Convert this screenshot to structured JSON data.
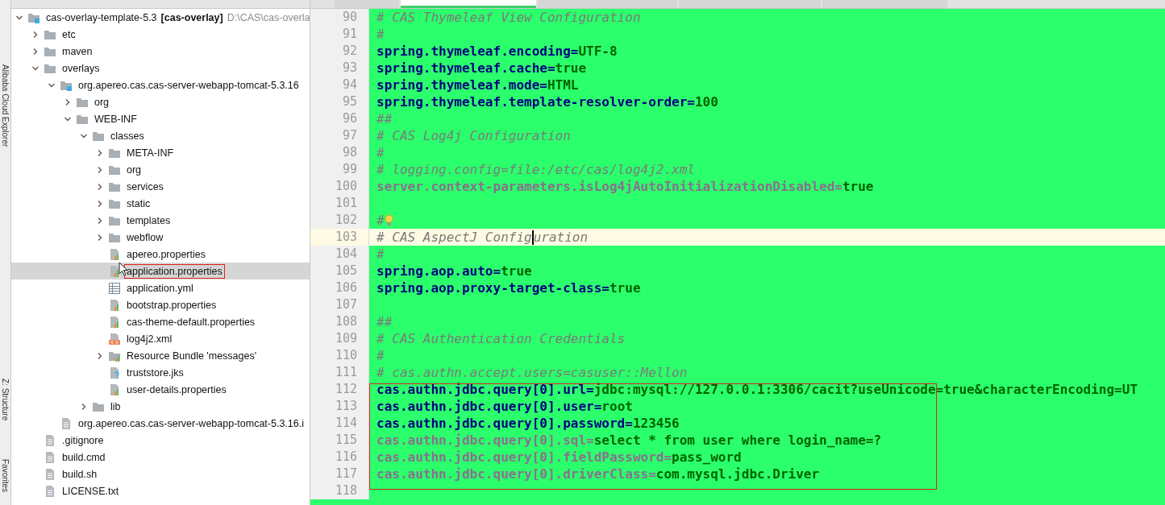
{
  "side_tools": [
    {
      "label": "Alibaba Cloud Explorer"
    },
    {
      "label": "Z: Structure"
    },
    {
      "label": "Favorites"
    }
  ],
  "editor_tabs": [
    {
      "selected": false
    },
    {
      "selected": true
    },
    {
      "selected": false
    },
    {
      "selected": false
    },
    {
      "selected": false
    }
  ],
  "project_tree": [
    {
      "name": "cas-overlay-template-5.3",
      "module": "[cas-overlay]",
      "path": "D:\\CAS\\cas-overla",
      "kind": "module",
      "expanded": true,
      "selected": false,
      "annotated": false,
      "children": [
        {
          "name": "etc",
          "kind": "folder",
          "expanded": false,
          "selected": false,
          "annotated": false
        },
        {
          "name": "maven",
          "kind": "folder",
          "expanded": false,
          "selected": false,
          "annotated": false
        },
        {
          "name": "overlays",
          "kind": "folder",
          "expanded": true,
          "selected": false,
          "annotated": false,
          "children": [
            {
              "name": "org.apereo.cas.cas-server-webapp-tomcat-5.3.16",
              "kind": "module",
              "expanded": true,
              "selected": false,
              "annotated": false,
              "children": [
                {
                  "name": "org",
                  "kind": "folder",
                  "expanded": false,
                  "selected": false,
                  "annotated": false
                },
                {
                  "name": "WEB-INF",
                  "kind": "folder",
                  "expanded": true,
                  "selected": false,
                  "annotated": false,
                  "children": [
                    {
                      "name": "classes",
                      "kind": "folder",
                      "expanded": true,
                      "selected": false,
                      "annotated": false,
                      "children": [
                        {
                          "name": "META-INF",
                          "kind": "folder",
                          "expanded": false,
                          "selected": false,
                          "annotated": false
                        },
                        {
                          "name": "org",
                          "kind": "folder",
                          "expanded": false,
                          "selected": false,
                          "annotated": false
                        },
                        {
                          "name": "services",
                          "kind": "folder",
                          "expanded": false,
                          "selected": false,
                          "annotated": false
                        },
                        {
                          "name": "static",
                          "kind": "folder",
                          "expanded": false,
                          "selected": false,
                          "annotated": false
                        },
                        {
                          "name": "templates",
                          "kind": "folder",
                          "expanded": false,
                          "selected": false,
                          "annotated": false
                        },
                        {
                          "name": "webflow",
                          "kind": "folder",
                          "expanded": false,
                          "selected": false,
                          "annotated": false
                        },
                        {
                          "name": "apereo.properties",
                          "kind": "properties",
                          "selected": false,
                          "annotated": false
                        },
                        {
                          "name": "application.properties",
                          "kind": "properties",
                          "selected": true,
                          "annotated": true
                        },
                        {
                          "name": "application.yml",
                          "kind": "yml",
                          "selected": false,
                          "annotated": false
                        },
                        {
                          "name": "bootstrap.properties",
                          "kind": "properties",
                          "selected": false,
                          "annotated": false
                        },
                        {
                          "name": "cas-theme-default.properties",
                          "kind": "properties",
                          "selected": false,
                          "annotated": false
                        },
                        {
                          "name": "log4j2.xml",
                          "kind": "xml",
                          "selected": false,
                          "annotated": false
                        },
                        {
                          "name": "Resource Bundle 'messages'",
                          "kind": "bundle",
                          "expanded": false,
                          "selected": false,
                          "annotated": false
                        },
                        {
                          "name": "truststore.jks",
                          "kind": "unknown",
                          "selected": false,
                          "annotated": false
                        },
                        {
                          "name": "user-details.properties",
                          "kind": "properties",
                          "selected": false,
                          "annotated": false
                        }
                      ]
                    },
                    {
                      "name": "lib",
                      "kind": "folder",
                      "expanded": false,
                      "selected": false,
                      "annotated": false
                    }
                  ]
                }
              ]
            },
            {
              "name": "org.apereo.cas.cas-server-webapp-tomcat-5.3.16.i",
              "kind": "text",
              "selected": false,
              "annotated": false
            }
          ]
        },
        {
          "name": ".gitignore",
          "kind": "text",
          "selected": false,
          "annotated": false
        },
        {
          "name": "build.cmd",
          "kind": "text",
          "selected": false,
          "annotated": false
        },
        {
          "name": "build.sh",
          "kind": "text",
          "selected": false,
          "annotated": false
        },
        {
          "name": "LICENSE.txt",
          "kind": "text",
          "selected": false,
          "annotated": false
        }
      ]
    }
  ],
  "code_lines": [
    {
      "number": "90",
      "kind": "comment",
      "text": "# CAS Thymeleaf View Configuration",
      "current": false
    },
    {
      "number": "91",
      "kind": "comment",
      "text": "#",
      "current": false
    },
    {
      "number": "92",
      "kind": "property",
      "key": "spring.thymeleaf.encoding=",
      "value": "UTF-8",
      "current": false
    },
    {
      "number": "93",
      "kind": "property",
      "key": "spring.thymeleaf.cache=",
      "value": "true",
      "current": false
    },
    {
      "number": "94",
      "kind": "property",
      "key": "spring.thymeleaf.mode=",
      "value": "HTML",
      "current": false
    },
    {
      "number": "95",
      "kind": "property",
      "key": "spring.thymeleaf.template-resolver-order=",
      "value": "100",
      "current": false
    },
    {
      "number": "96",
      "kind": "comment",
      "text": "##",
      "current": false
    },
    {
      "number": "97",
      "kind": "comment",
      "text": "# CAS Log4j Configuration",
      "current": false
    },
    {
      "number": "98",
      "kind": "comment",
      "text": "#",
      "current": false
    },
    {
      "number": "99",
      "kind": "comment",
      "text": "# logging.config=file:/etc/cas/log4j2.xml",
      "current": false
    },
    {
      "number": "100",
      "kind": "unused_property",
      "key": "server.context-parameters.isLog4jAutoInitializationDisabled=",
      "value": "true",
      "current": false
    },
    {
      "number": "101",
      "kind": "blank",
      "current": false
    },
    {
      "number": "102",
      "kind": "comment",
      "text": "#",
      "current": false,
      "bulb": true
    },
    {
      "number": "103",
      "kind": "comment",
      "text": "# CAS AspectJ Config",
      "after_caret": "uration",
      "current": true
    },
    {
      "number": "104",
      "kind": "comment",
      "text": "#",
      "current": false
    },
    {
      "number": "105",
      "kind": "property",
      "key": "spring.aop.auto=",
      "value": "true",
      "current": false
    },
    {
      "number": "106",
      "kind": "property",
      "key": "spring.aop.proxy-target-class=",
      "value": "true",
      "current": false
    },
    {
      "number": "107",
      "kind": "blank",
      "current": false
    },
    {
      "number": "108",
      "kind": "comment",
      "text": "##",
      "current": false
    },
    {
      "number": "109",
      "kind": "comment",
      "text": "# CAS Authentication Credentials",
      "current": false
    },
    {
      "number": "110",
      "kind": "comment",
      "text": "#",
      "current": false
    },
    {
      "number": "111",
      "kind": "comment",
      "text": "# cas.authn.accept.users=casuser::Mellon",
      "current": false
    },
    {
      "number": "112",
      "kind": "property",
      "key": "cas.authn.jdbc.query[0].url=",
      "value": "jdbc:mysql://127.0.0.1:3306/cacit?useUnicode=true&characterEncoding=UT",
      "current": false,
      "annotated": true
    },
    {
      "number": "113",
      "kind": "property",
      "key": "cas.authn.jdbc.query[0].user=",
      "value": "root",
      "current": false,
      "annotated": true
    },
    {
      "number": "114",
      "kind": "property",
      "key": "cas.authn.jdbc.query[0].password=",
      "value": "123456",
      "current": false,
      "annotated": true
    },
    {
      "number": "115",
      "kind": "unused_property",
      "key": "cas.authn.jdbc.query[0].sql=",
      "value": "select * from user where login_name=?",
      "current": false,
      "annotated": true
    },
    {
      "number": "116",
      "kind": "unused_property",
      "key": "cas.authn.jdbc.query[0].fieldPassword=",
      "value": "pass_word",
      "current": false,
      "annotated": true
    },
    {
      "number": "117",
      "kind": "unused_property",
      "key": "cas.authn.jdbc.query[0].driverClass=",
      "value": "com.mysql.jdbc.Driver",
      "current": false,
      "annotated": true
    },
    {
      "number": "118",
      "kind": "blank",
      "current": false
    }
  ]
}
